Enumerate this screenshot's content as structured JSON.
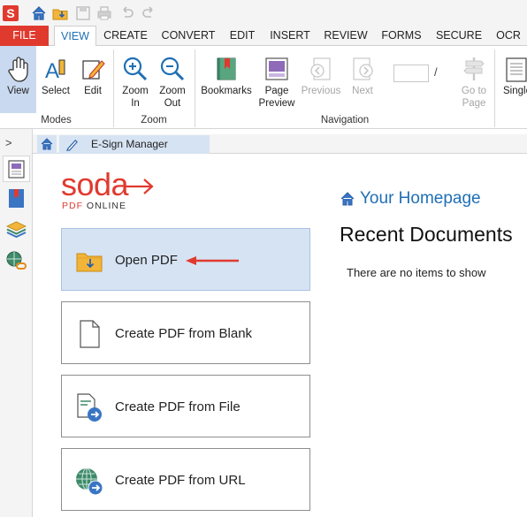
{
  "titlebar": {
    "app_logo": "S",
    "quick_access": [
      "home-icon",
      "open-folder-icon",
      "save-icon",
      "print-icon",
      "undo-icon",
      "redo-icon"
    ]
  },
  "tabs": [
    {
      "label": "FILE"
    },
    {
      "label": "VIEW"
    },
    {
      "label": "CREATE"
    },
    {
      "label": "CONVERT"
    },
    {
      "label": "EDIT"
    },
    {
      "label": "INSERT"
    },
    {
      "label": "REVIEW"
    },
    {
      "label": "FORMS"
    },
    {
      "label": "SECURE"
    },
    {
      "label": "OCR"
    }
  ],
  "ribbon": {
    "modes": {
      "group_label": "Modes",
      "view": "View",
      "select": "Select",
      "edit": "Edit"
    },
    "zoom": {
      "group_label": "Zoom",
      "zoom_in": "Zoom\nIn",
      "zoom_in_1": "Zoom",
      "zoom_in_2": "In",
      "zoom_out_1": "Zoom",
      "zoom_out_2": "Out"
    },
    "navigation": {
      "group_label": "Navigation",
      "bookmarks": "Bookmarks",
      "page_preview_1": "Page",
      "page_preview_2": "Preview",
      "previous": "Previous",
      "next": "Next",
      "page_input": "",
      "page_sep": "/",
      "goto_1": "Go to",
      "goto_2": "Page"
    },
    "single": "Single"
  },
  "sidebar": {
    "collapse": ">",
    "tools": [
      "thumbnails-icon",
      "bookmarks-icon",
      "layers-icon",
      "links-icon"
    ]
  },
  "doc_tabs": {
    "esign": "E-Sign Manager"
  },
  "home": {
    "logo_main": "soda",
    "logo_sub": "PDF ONLINE",
    "homepage_title": "Your Homepage",
    "recent_title": "Recent Documents",
    "empty_message": "There are no items to show",
    "actions": [
      {
        "label": "Open PDF"
      },
      {
        "label": "Create PDF from Blank"
      },
      {
        "label": "Create PDF from File"
      },
      {
        "label": "Create PDF from URL"
      }
    ]
  },
  "colors": {
    "brand_red": "#e03a2f",
    "accent_blue": "#1f6fb5",
    "selected_bg": "#d6e3f3"
  }
}
